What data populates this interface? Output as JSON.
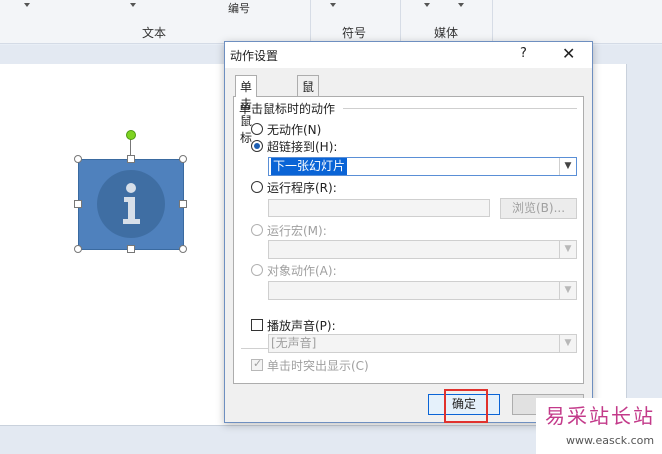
{
  "ribbon": {
    "groups": [
      "文本",
      "编号",
      "符号",
      "媒体"
    ]
  },
  "dialog": {
    "title": "动作设置",
    "help": "?",
    "close": "✕",
    "tabs": [
      "单击鼠标",
      "鼠标移过"
    ],
    "group_title": "单击鼠标时的动作",
    "options": {
      "none": "无动作(N)",
      "hyperlink": "超链接到(H):",
      "run_program": "运行程序(R):",
      "run_macro": "运行宏(M):",
      "object_action": "对象动作(A):"
    },
    "hyperlink_value": "下一张幻灯片",
    "browse_button": "浏览(B)...",
    "play_sound": "播放声音(P):",
    "sound_value": "[无声音]",
    "highlight_click": "单击时突出显示(C)",
    "ok_button": "确定",
    "cancel_button": "取"
  },
  "watermark": {
    "main": "易采站长站",
    "sub": "www.easck.com"
  },
  "colors": {
    "shape": "#4f81bd",
    "highlight_box": "#e0322e",
    "selection": "#0a64d6"
  }
}
